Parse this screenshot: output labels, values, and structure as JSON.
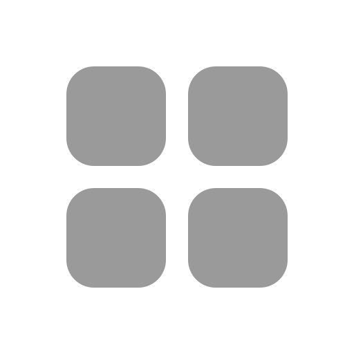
{
  "icon": {
    "name": "grid-icon",
    "tile_color": "#9a9a9a",
    "background_color": "#ffffff"
  }
}
